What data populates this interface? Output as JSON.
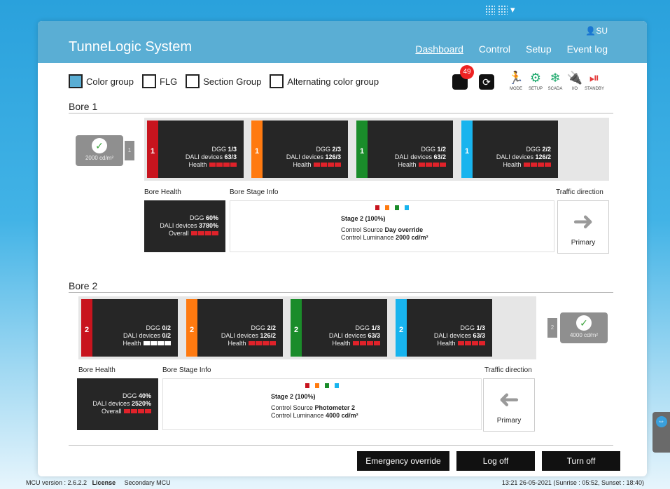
{
  "app": {
    "title": "TunneLogic System",
    "user": "SU"
  },
  "nav": [
    {
      "label": "Dashboard",
      "active": true
    },
    {
      "label": "Control"
    },
    {
      "label": "Setup"
    },
    {
      "label": "Event log"
    }
  ],
  "groups": [
    {
      "label": "Color group",
      "checked": true
    },
    {
      "label": "FLG",
      "checked": false
    },
    {
      "label": "Section Group",
      "checked": false
    },
    {
      "label": "Alternating color group",
      "checked": false
    }
  ],
  "alerts": {
    "count": "49"
  },
  "tools": [
    {
      "icon": "running-man-icon",
      "label": "MODE",
      "color": "#1aa86a"
    },
    {
      "icon": "gear-icon",
      "label": "SETUP",
      "color": "#1aa86a"
    },
    {
      "icon": "snowflake-icon",
      "label": "SCADA",
      "color": "#1aa86a"
    },
    {
      "icon": "plug-icon",
      "label": "I/O",
      "color": "#e43a3a"
    },
    {
      "icon": "standby-icon",
      "label": "STANDBY",
      "color": "#e43a3a"
    }
  ],
  "colors": {
    "red": "#c8141e",
    "orange": "#ff7a10",
    "green": "#1a8c2a",
    "blue": "#18b4ee",
    "health_red": "#e0222a",
    "health_white": "#ffffff"
  },
  "bore1": {
    "title": "Bore 1",
    "luminance": "2000 cd/m²",
    "lamp": "1",
    "cards": [
      {
        "num": "1",
        "dgg": "1/3",
        "dali": "63/3",
        "color": "red"
      },
      {
        "num": "1",
        "dgg": "2/3",
        "dali": "126/3",
        "color": "orange"
      },
      {
        "num": "1",
        "dgg": "1/2",
        "dali": "63/2",
        "color": "green"
      },
      {
        "num": "1",
        "dgg": "2/2",
        "dali": "126/2",
        "color": "blue"
      }
    ],
    "health": {
      "dgg": "60%",
      "dali": "3780%"
    },
    "stage": {
      "title": "Stage 2 (100%)",
      "source": "Day override",
      "lum": "2000 cd/m²"
    },
    "traffic": {
      "label": "Primary",
      "direction": "right"
    }
  },
  "bore2": {
    "title": "Bore 2",
    "luminance": "4000 cd/m²",
    "lamp": "2",
    "cards": [
      {
        "num": "2",
        "dgg": "0/2",
        "dali": "0/2",
        "color": "red",
        "health": "white"
      },
      {
        "num": "2",
        "dgg": "2/2",
        "dali": "126/2",
        "color": "orange"
      },
      {
        "num": "2",
        "dgg": "1/3",
        "dali": "63/3",
        "color": "green"
      },
      {
        "num": "2",
        "dgg": "1/3",
        "dali": "63/3",
        "color": "blue"
      }
    ],
    "health": {
      "dgg": "40%",
      "dali": "2520%"
    },
    "stage": {
      "title": "Stage 2 (100%)",
      "source": "Photometer 2",
      "lum": "4000 cd/m²"
    },
    "traffic": {
      "label": "Primary",
      "direction": "left"
    }
  },
  "labels": {
    "dgg": "DGG",
    "dali": "DALI devices",
    "health": "Health",
    "overall": "Overall",
    "bore_health": "Bore Health",
    "bore_stage": "Bore Stage Info",
    "traffic": "Traffic direction",
    "control_source": "Control Source",
    "control_lum": "Control Luminance"
  },
  "buttons": {
    "emergency": "Emergency override",
    "logoff": "Log off",
    "turnoff": "Turn off"
  },
  "footer": {
    "mcu_version": "MCU version : 2.6.2.2",
    "license": "License",
    "secondary": "Secondary MCU",
    "datetime": "13:21 26-05-2021 (Sunrise : 05:52, Sunset : 18:40)"
  }
}
